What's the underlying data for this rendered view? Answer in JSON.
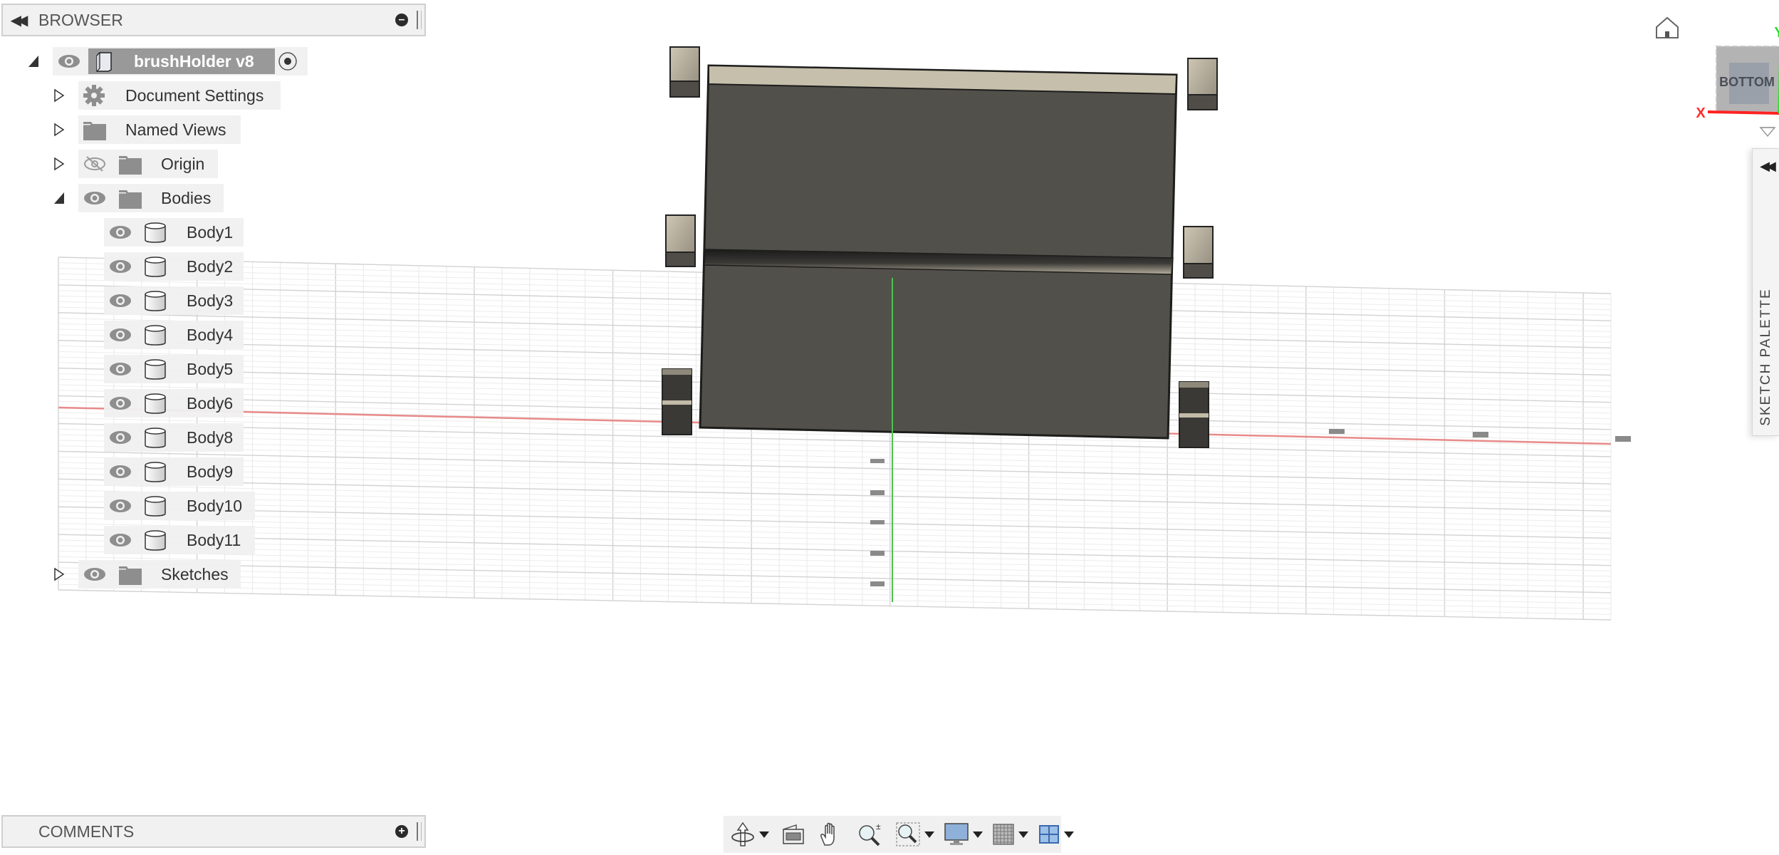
{
  "browser": {
    "title": "BROWSER",
    "root": {
      "label": "brushHolder v8",
      "expanded": true,
      "visible": true,
      "active": true
    },
    "items": [
      {
        "label": "Document Settings",
        "icon": "gear-icon",
        "expanded": false,
        "has_eye": false
      },
      {
        "label": "Named Views",
        "icon": "folder-icon",
        "expanded": false,
        "has_eye": false
      },
      {
        "label": "Origin",
        "icon": "folder-icon",
        "expanded": false,
        "has_eye": true,
        "visible": false
      },
      {
        "label": "Bodies",
        "icon": "folder-icon",
        "expanded": true,
        "has_eye": true,
        "visible": true
      }
    ],
    "bodies": [
      {
        "label": "Body1",
        "visible": true
      },
      {
        "label": "Body2",
        "visible": true
      },
      {
        "label": "Body3",
        "visible": true
      },
      {
        "label": "Body4",
        "visible": true
      },
      {
        "label": "Body5",
        "visible": true
      },
      {
        "label": "Body6",
        "visible": true
      },
      {
        "label": "Body8",
        "visible": true
      },
      {
        "label": "Body9",
        "visible": true
      },
      {
        "label": "Body10",
        "visible": true
      },
      {
        "label": "Body11",
        "visible": true
      }
    ],
    "sketches": {
      "label": "Sketches",
      "expanded": false,
      "visible": true
    }
  },
  "comments": {
    "title": "COMMENTS"
  },
  "viewcube": {
    "face_label": "BOTTOM",
    "axis_x": "X",
    "axis_y": "Y"
  },
  "sketch_palette": {
    "title": "SKETCH PALETTE"
  },
  "nav_toolbar": [
    {
      "name": "orbit",
      "icon": "orbit-icon",
      "dropdown": true
    },
    {
      "name": "look-at",
      "icon": "look-at-icon",
      "dropdown": false
    },
    {
      "name": "pan",
      "icon": "pan-hand-icon",
      "dropdown": false
    },
    {
      "name": "zoom",
      "icon": "zoom-icon",
      "dropdown": false
    },
    {
      "name": "fit",
      "icon": "zoom-window-icon",
      "dropdown": true
    },
    {
      "name": "display-settings",
      "icon": "display-icon",
      "dropdown": true
    },
    {
      "name": "grid-snaps",
      "icon": "grid-icon",
      "dropdown": true
    },
    {
      "name": "viewports",
      "icon": "viewports-icon",
      "dropdown": true
    }
  ],
  "colors": {
    "axis_x": "#e53935",
    "axis_y": "#22c322",
    "model_body": "#52504b",
    "model_face_light": "#c8c0ad",
    "panel_bg": "#f1f1f1",
    "row_selected": "#999999"
  }
}
